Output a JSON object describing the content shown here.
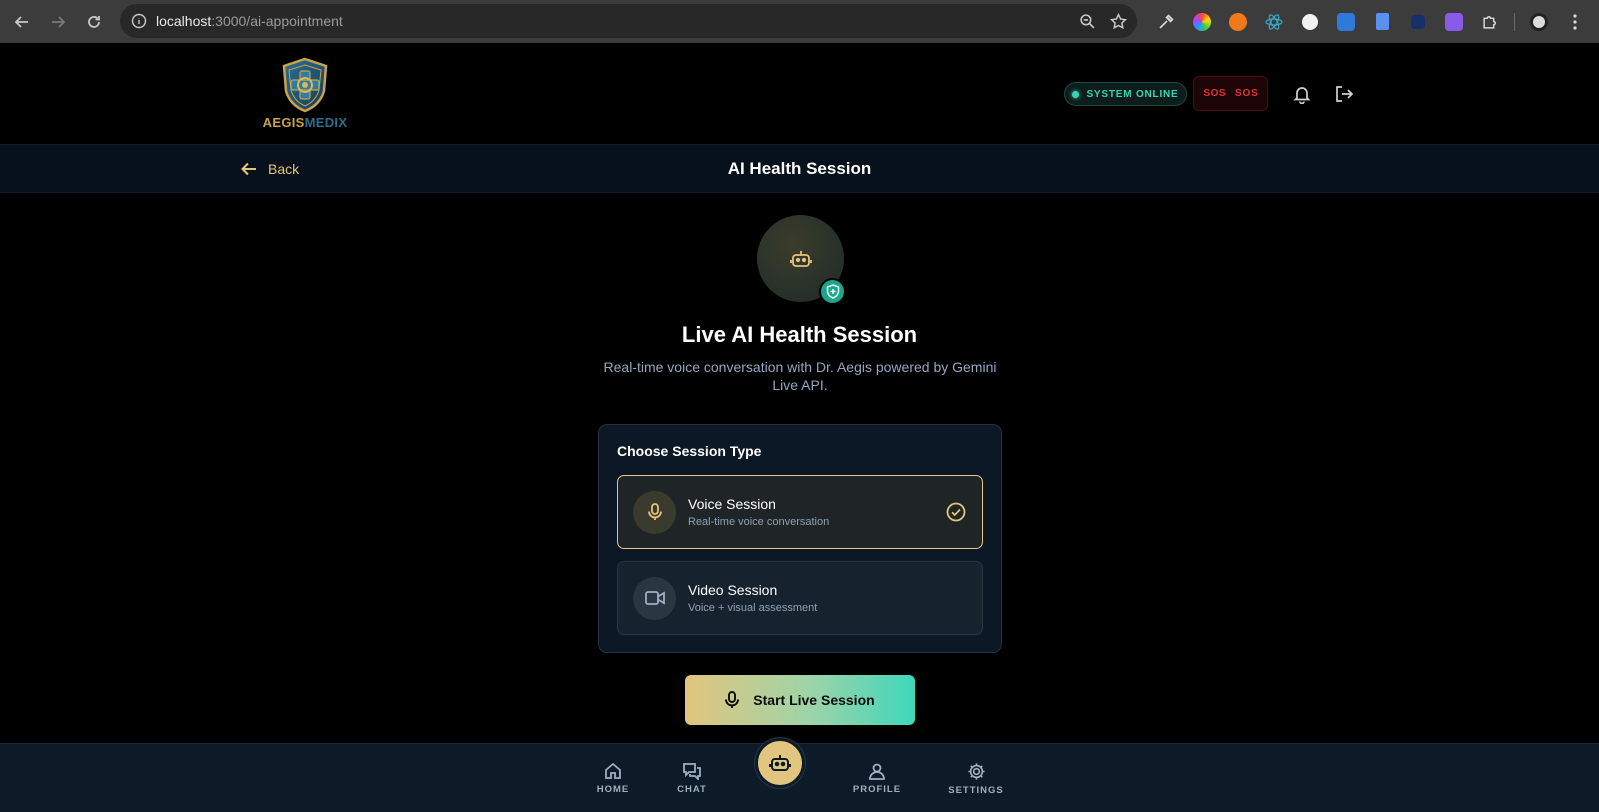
{
  "browser": {
    "url_host": "localhost",
    "url_path": ":3000/ai-appointment"
  },
  "header": {
    "logo_part1": "AEGIS",
    "logo_part2": "MEDIX",
    "status_label": "SYSTEM ONLINE",
    "sos_icon_text": "SOS",
    "sos_label": "SOS"
  },
  "subheader": {
    "back_label": "Back",
    "title": "AI Health Session"
  },
  "main": {
    "title": "Live AI Health Session",
    "subtitle": "Real-time voice conversation with Dr. Aegis powered by Gemini Live API.",
    "card_title": "Choose Session Type",
    "options": [
      {
        "label": "Voice Session",
        "desc": "Real-time voice conversation",
        "selected": true,
        "icon": "microphone-icon"
      },
      {
        "label": "Video Session",
        "desc": "Voice + visual assessment",
        "selected": false,
        "icon": "video-camera-icon"
      }
    ],
    "start_label": "Start Live Session"
  },
  "bottom_nav": {
    "items": [
      {
        "label": "HOME",
        "icon": "home-icon"
      },
      {
        "label": "CHAT",
        "icon": "chat-icon"
      },
      {
        "label": "PROFILE",
        "icon": "user-icon"
      },
      {
        "label": "SETTINGS",
        "icon": "gear-icon"
      }
    ],
    "fab_icon": "robot-icon"
  },
  "colors": {
    "accent_gold": "#e6c47a",
    "accent_teal": "#3ed3b0",
    "danger": "#e0343d",
    "background": "#000000",
    "panel": "#0c1825"
  }
}
